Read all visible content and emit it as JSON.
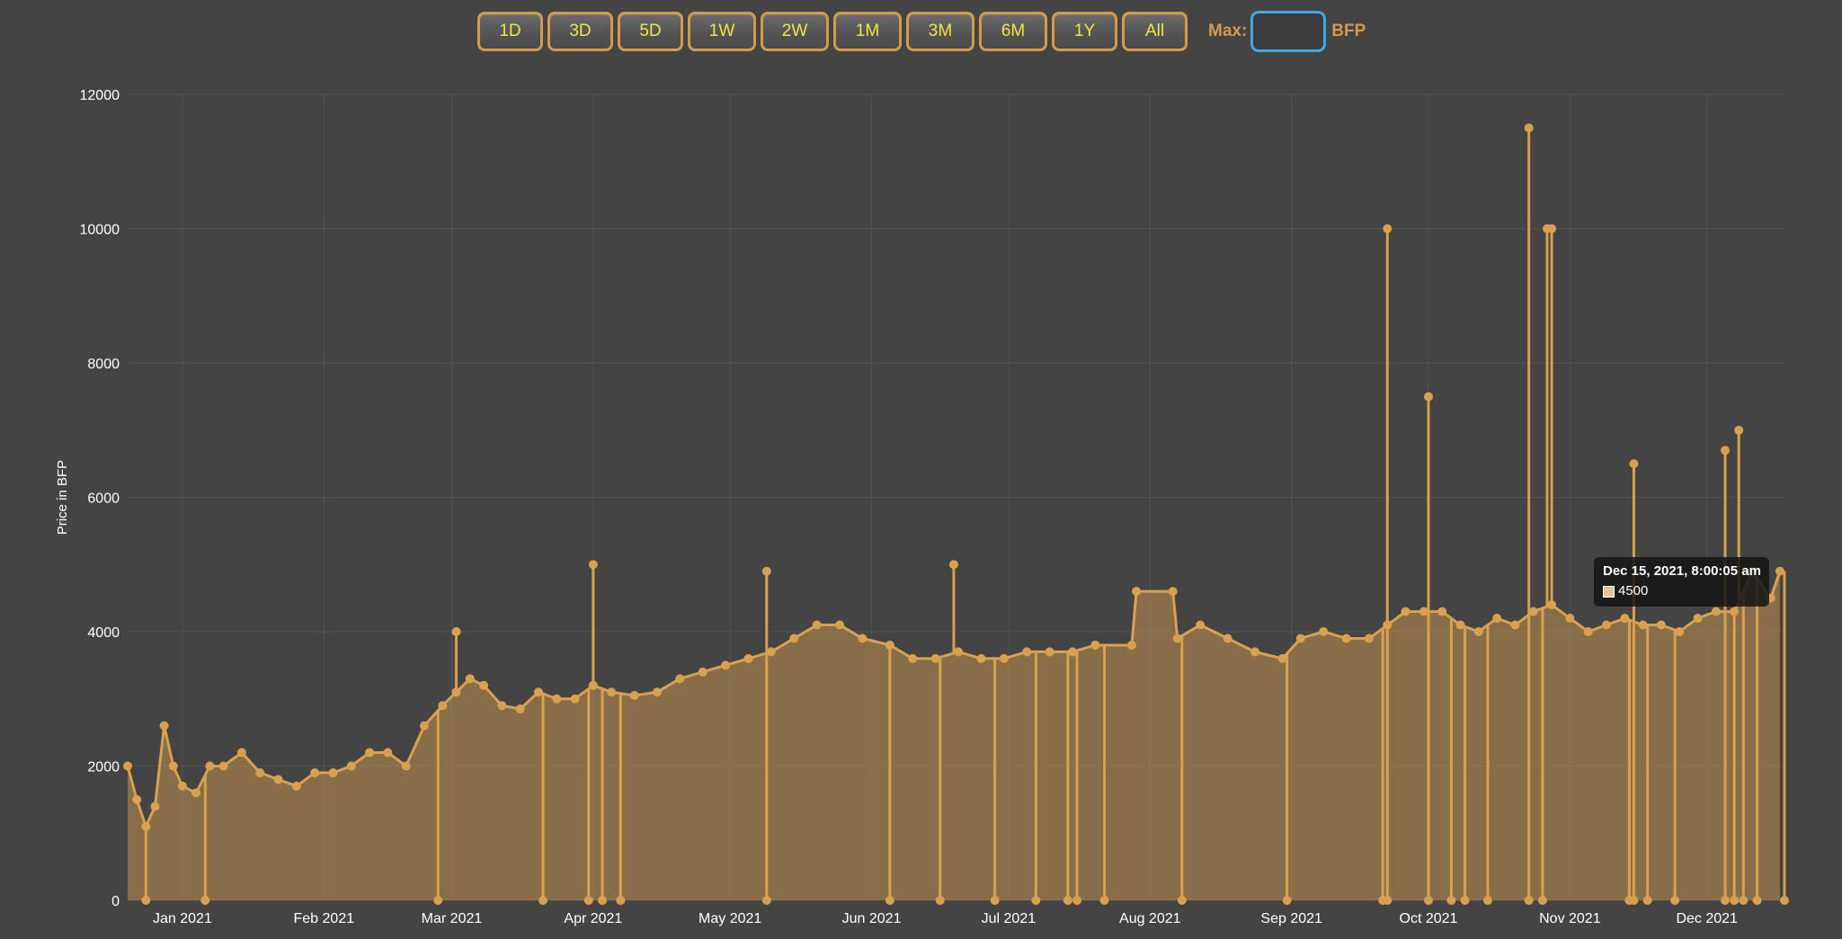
{
  "range_buttons": [
    {
      "label": "1D"
    },
    {
      "label": "3D"
    },
    {
      "label": "5D"
    },
    {
      "label": "1W"
    },
    {
      "label": "2W"
    },
    {
      "label": "1M"
    },
    {
      "label": "3M"
    },
    {
      "label": "6M"
    },
    {
      "label": "1Y"
    },
    {
      "label": "All"
    }
  ],
  "max_filter": {
    "label": "Max:",
    "value": "",
    "unit": "BFP"
  },
  "colors": {
    "accent": "#d49a4a",
    "button_text": "#f3e24a",
    "input_border": "#3fa9e0",
    "background": "#444444",
    "series": "#d9a04e"
  },
  "tooltip": {
    "title": "Dec 15, 2021, 8:00:05 am",
    "value": "4500"
  },
  "chart_data": {
    "type": "area",
    "title": "",
    "xlabel": "",
    "ylabel": "Price in BFP",
    "ylim": [
      0,
      12000
    ],
    "y_ticks": [
      0,
      2000,
      4000,
      6000,
      8000,
      10000,
      12000
    ],
    "x_tick_labels": [
      "Jan 2021",
      "Feb 2021",
      "Mar 2021",
      "Apr 2021",
      "May 2021",
      "Jun 2021",
      "Jul 2021",
      "Aug 2021",
      "Sep 2021",
      "Oct 2021",
      "Nov 2021",
      "Dec 2021"
    ],
    "x_tick_dates": [
      "2021-01-01",
      "2021-02-01",
      "2021-03-01",
      "2021-04-01",
      "2021-05-01",
      "2021-06-01",
      "2021-07-01",
      "2021-08-01",
      "2021-09-01",
      "2021-10-01",
      "2021-11-01",
      "2021-12-01"
    ],
    "xlim": [
      "2020-12-20",
      "2021-12-18"
    ],
    "grid": true,
    "series": [
      {
        "values": [
          [
            "2020-12-20",
            2000
          ],
          [
            "2020-12-22",
            1500
          ],
          [
            "2020-12-24",
            1100
          ],
          [
            "2020-12-26",
            1400
          ],
          [
            "2020-12-28",
            2600
          ],
          [
            "2020-12-30",
            2000
          ],
          [
            "2021-01-01",
            1700
          ],
          [
            "2021-01-04",
            1600
          ],
          [
            "2021-01-07",
            2000
          ],
          [
            "2021-01-10",
            2000
          ],
          [
            "2021-01-14",
            2200
          ],
          [
            "2021-01-18",
            1900
          ],
          [
            "2021-01-22",
            1800
          ],
          [
            "2021-01-26",
            1700
          ],
          [
            "2021-01-30",
            1900
          ],
          [
            "2021-02-03",
            1900
          ],
          [
            "2021-02-07",
            2000
          ],
          [
            "2021-02-11",
            2200
          ],
          [
            "2021-02-15",
            2200
          ],
          [
            "2021-02-19",
            2000
          ],
          [
            "2021-02-23",
            2600
          ],
          [
            "2021-02-27",
            2900
          ],
          [
            "2021-03-02",
            3100
          ],
          [
            "2021-03-05",
            3300
          ],
          [
            "2021-03-08",
            3200
          ],
          [
            "2021-03-12",
            2900
          ],
          [
            "2021-03-16",
            2850
          ],
          [
            "2021-03-20",
            3100
          ],
          [
            "2021-03-24",
            3000
          ],
          [
            "2021-03-28",
            3000
          ],
          [
            "2021-04-01",
            3200
          ],
          [
            "2021-04-05",
            3100
          ],
          [
            "2021-04-10",
            3050
          ],
          [
            "2021-04-15",
            3100
          ],
          [
            "2021-04-20",
            3300
          ],
          [
            "2021-04-25",
            3400
          ],
          [
            "2021-04-30",
            3500
          ],
          [
            "2021-05-05",
            3600
          ],
          [
            "2021-05-10",
            3700
          ],
          [
            "2021-05-15",
            3900
          ],
          [
            "2021-05-20",
            4100
          ],
          [
            "2021-05-25",
            4100
          ],
          [
            "2021-05-30",
            3900
          ],
          [
            "2021-06-05",
            3800
          ],
          [
            "2021-06-10",
            3600
          ],
          [
            "2021-06-15",
            3600
          ],
          [
            "2021-06-20",
            3700
          ],
          [
            "2021-06-25",
            3600
          ],
          [
            "2021-06-30",
            3600
          ],
          [
            "2021-07-05",
            3700
          ],
          [
            "2021-07-10",
            3700
          ],
          [
            "2021-07-15",
            3700
          ],
          [
            "2021-07-20",
            3800
          ],
          [
            "2021-07-28",
            3800
          ],
          [
            "2021-07-29",
            4600
          ],
          [
            "2021-08-06",
            4600
          ],
          [
            "2021-08-07",
            3900
          ],
          [
            "2021-08-12",
            4100
          ],
          [
            "2021-08-18",
            3900
          ],
          [
            "2021-08-24",
            3700
          ],
          [
            "2021-08-30",
            3600
          ],
          [
            "2021-09-03",
            3900
          ],
          [
            "2021-09-08",
            4000
          ],
          [
            "2021-09-13",
            3900
          ],
          [
            "2021-09-18",
            3900
          ],
          [
            "2021-09-22",
            4100
          ],
          [
            "2021-09-26",
            4300
          ],
          [
            "2021-09-30",
            4300
          ],
          [
            "2021-10-04",
            4300
          ],
          [
            "2021-10-08",
            4100
          ],
          [
            "2021-10-12",
            4000
          ],
          [
            "2021-10-16",
            4200
          ],
          [
            "2021-10-20",
            4100
          ],
          [
            "2021-10-24",
            4300
          ],
          [
            "2021-10-28",
            4400
          ],
          [
            "2021-11-01",
            4200
          ],
          [
            "2021-11-05",
            4000
          ],
          [
            "2021-11-09",
            4100
          ],
          [
            "2021-11-13",
            4200
          ],
          [
            "2021-11-17",
            4100
          ],
          [
            "2021-11-21",
            4100
          ],
          [
            "2021-11-25",
            4000
          ],
          [
            "2021-11-29",
            4200
          ],
          [
            "2021-12-03",
            4300
          ],
          [
            "2021-12-07",
            4300
          ],
          [
            "2021-12-11",
            4900
          ],
          [
            "2021-12-15",
            4500
          ],
          [
            "2021-12-17",
            4900
          ]
        ]
      }
    ],
    "spikes": [
      [
        "2021-09-22",
        10000
      ],
      [
        "2021-10-01",
        7500
      ],
      [
        "2021-10-23",
        11500
      ],
      [
        "2021-10-27",
        10000
      ],
      [
        "2021-10-28",
        10000
      ],
      [
        "2021-12-05",
        6700
      ],
      [
        "2021-12-08",
        7000
      ],
      [
        "2021-11-15",
        6500
      ],
      [
        "2021-04-01",
        5000
      ],
      [
        "2021-05-09",
        4900
      ],
      [
        "2021-06-19",
        5000
      ],
      [
        "2021-03-02",
        4000
      ]
    ],
    "drops": [
      "2020-12-24",
      "2021-01-06",
      "2021-02-26",
      "2021-03-21",
      "2021-03-31",
      "2021-04-03",
      "2021-04-07",
      "2021-05-09",
      "2021-06-05",
      "2021-06-16",
      "2021-06-28",
      "2021-07-07",
      "2021-07-14",
      "2021-07-16",
      "2021-07-22",
      "2021-08-08",
      "2021-08-31",
      "2021-09-21",
      "2021-09-22",
      "2021-10-01",
      "2021-10-06",
      "2021-10-09",
      "2021-10-14",
      "2021-10-23",
      "2021-10-26",
      "2021-11-14",
      "2021-11-15",
      "2021-11-18",
      "2021-11-24",
      "2021-12-05",
      "2021-12-07",
      "2021-12-09",
      "2021-12-12",
      "2021-12-18"
    ]
  }
}
